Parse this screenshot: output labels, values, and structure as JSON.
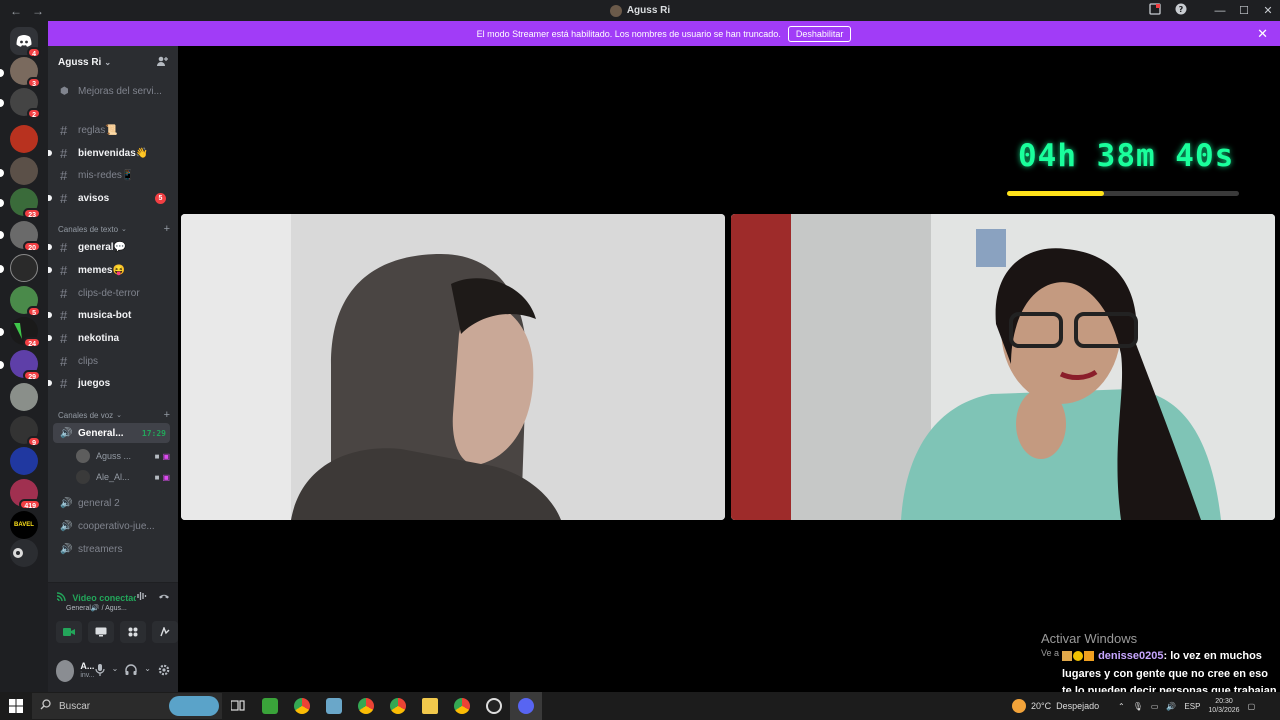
{
  "window": {
    "title": "Aguss Ri",
    "back_glyph": "←",
    "forward_glyph": "→"
  },
  "banner": {
    "text": "El modo Streamer está habilitado. Los nombres de usuario se han truncado.",
    "button": "Deshabilitar"
  },
  "rail": {
    "badges": [
      "4",
      "3",
      "2",
      "23",
      "20",
      "5",
      "24",
      "29",
      "9",
      "419"
    ],
    "bavel_label": "BAVEL"
  },
  "server": {
    "name": "Aguss Ri",
    "boost_item": "Mejoras del servi...",
    "channels_top": [
      {
        "name": "reglas📜",
        "unread": false
      },
      {
        "name": "bienvenidas👋",
        "unread": true
      },
      {
        "name": "mis-redes📱",
        "unread": false
      },
      {
        "name": "avisos",
        "unread": true,
        "badge": "5"
      }
    ],
    "text_category": "Canales de texto",
    "text_channels": [
      {
        "name": "general💬",
        "unread": true
      },
      {
        "name": "memes😝",
        "unread": true
      },
      {
        "name": "clips-de-terror",
        "unread": false
      },
      {
        "name": "musica-bot",
        "unread": true
      },
      {
        "name": "nekotina",
        "unread": true
      },
      {
        "name": "clips",
        "unread": false
      },
      {
        "name": "juegos",
        "unread": true
      }
    ],
    "voice_category": "Canales de voz",
    "voice_channels": [
      {
        "name": "General...",
        "time": "17:29",
        "active": true
      },
      {
        "name": "general 2"
      },
      {
        "name": "cooperativo-jue..."
      },
      {
        "name": "streamers"
      }
    ],
    "voice_users": [
      {
        "name": "Aguss ..."
      },
      {
        "name": "Ale_Al..."
      }
    ]
  },
  "voice_panel": {
    "status": "Video conectado",
    "location": "General🔊 / Agus..."
  },
  "user_panel": {
    "name": "A...",
    "status": "inv..."
  },
  "stream": {
    "timer": "04h 38m 40s",
    "timer_progress": 0.42
  },
  "overlay": {
    "watermark_title": "Activar Windows",
    "watermark_sub": "Ve a",
    "chat_user": "denisse0205",
    "chat_message": ": lo vez en muchos lugares y con gente que no cree en eso te lo pueden decir personas que trabajan en morgue"
  },
  "taskbar": {
    "search_placeholder": "Buscar",
    "temperature": "20°C",
    "weather_text": "Despejado",
    "language": "ESP",
    "time": "20:30",
    "date": "10/3/2026"
  },
  "colors": {
    "accent": "#a13cf7",
    "timer": "#1aff9c",
    "timer_bar": "#ffe21a",
    "badge": "#f23f43",
    "voice_green": "#23a55a"
  }
}
